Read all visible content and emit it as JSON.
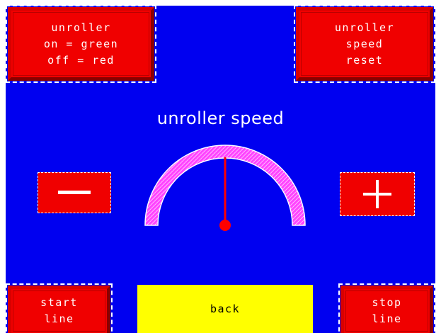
{
  "top_left_button": {
    "lines": [
      "unroller",
      "on = green",
      "off = red"
    ]
  },
  "top_right_button": {
    "lines": [
      "unroller",
      "speed",
      "reset"
    ]
  },
  "gauge": {
    "title": "unroller speed",
    "value_fraction": 0.5,
    "arc_color": "#ff44ff",
    "needle_color": "#ff0000"
  },
  "minus_button": {
    "icon": "minus-icon",
    "symbol": "−"
  },
  "plus_button": {
    "icon": "plus-icon",
    "symbol": "+"
  },
  "start_button": {
    "lines": [
      "start",
      "line"
    ]
  },
  "stop_button": {
    "lines": [
      "stop",
      "line"
    ]
  },
  "back_button": {
    "label": "back"
  },
  "colors": {
    "background": "#0000f0",
    "button_red": "#f00000",
    "back_yellow": "#ffff00"
  }
}
